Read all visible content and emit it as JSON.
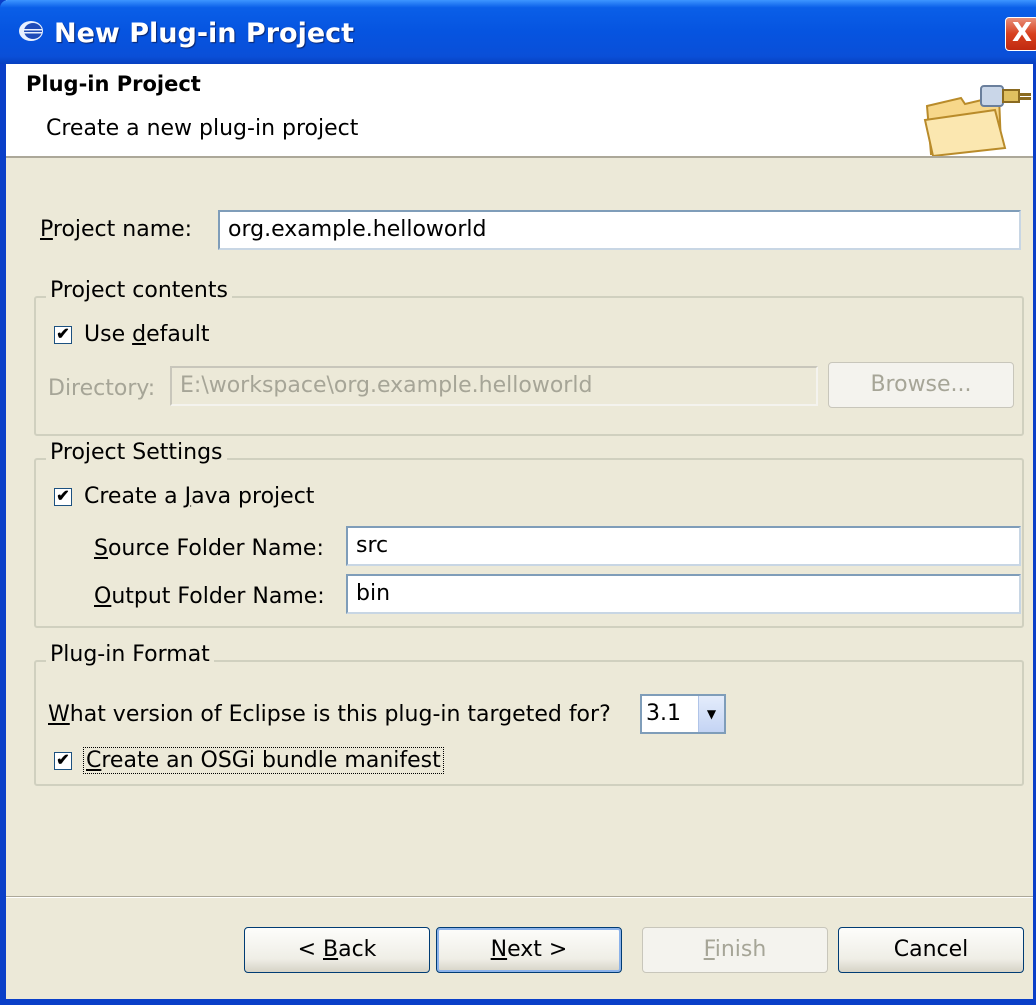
{
  "window": {
    "title": "New Plug-in Project",
    "close_label": "X"
  },
  "header": {
    "title": "Plug-in Project",
    "description": "Create a new plug-in project"
  },
  "project_name": {
    "label_u": "P",
    "label_rest": "roject name:",
    "value": "org.example.helloworld"
  },
  "project_contents": {
    "group_title": "Project contents",
    "use_default": {
      "pre": "Use ",
      "u": "d",
      "rest": "efault",
      "checked": true
    },
    "directory": {
      "label": "Directory:",
      "value": "E:\\workspace\\org.example.helloworld"
    },
    "browse_label": "Browse..."
  },
  "project_settings": {
    "group_title": "Project Settings",
    "create_java": {
      "pre": "Create a ",
      "u": "J",
      "rest": "ava project",
      "checked": true
    },
    "source_folder": {
      "label_u": "S",
      "label_rest": "ource Folder Name:",
      "value": "src"
    },
    "output_folder": {
      "label_u": "O",
      "label_rest": "utput Folder Name:",
      "value": "bin"
    }
  },
  "plugin_format": {
    "group_title": "Plug-in Format",
    "version_question_u": "W",
    "version_question_rest": "hat version of Eclipse is this plug-in targeted for?",
    "version_value": "3.1",
    "osgi": {
      "pre": "",
      "u": "C",
      "rest": "reate an OSGi bundle manifest",
      "checked": true
    }
  },
  "buttons": {
    "back": {
      "pre": "< ",
      "u": "B",
      "rest": "ack"
    },
    "next": {
      "pre": "",
      "u": "N",
      "rest": "ext >"
    },
    "finish": {
      "pre": "",
      "u": "F",
      "rest": "inish"
    },
    "cancel": {
      "label": "Cancel"
    }
  },
  "colors": {
    "title_bar": "#0654e0",
    "dialog_bg": "#ece9d8",
    "accent": "#003c74"
  }
}
